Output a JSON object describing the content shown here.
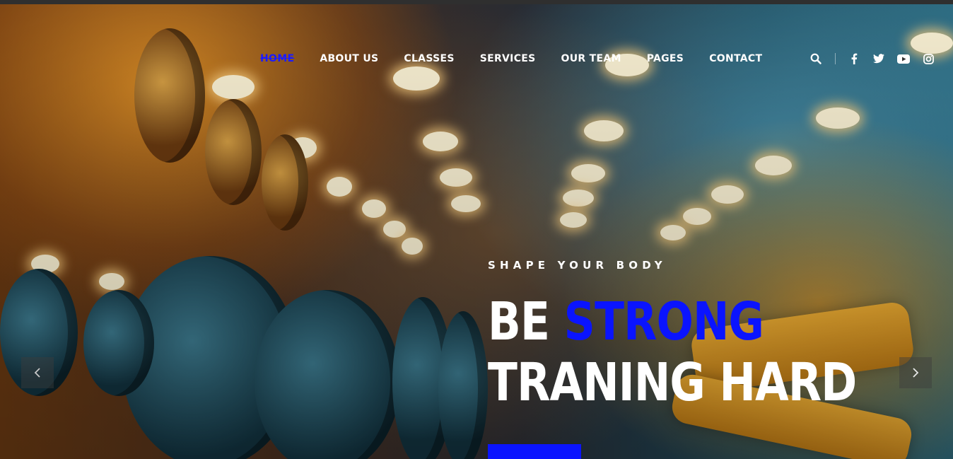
{
  "nav": {
    "items": [
      {
        "label": "HOME",
        "active": true
      },
      {
        "label": "ABOUT US"
      },
      {
        "label": "CLASSES"
      },
      {
        "label": "SERVICES"
      },
      {
        "label": "OUR TEAM"
      },
      {
        "label": "PAGES"
      },
      {
        "label": "CONTACT"
      }
    ]
  },
  "tools": {
    "icons": [
      "search-icon",
      "facebook-icon",
      "twitter-icon",
      "youtube-icon",
      "instagram-icon"
    ]
  },
  "hero": {
    "subtitle": "SHAPE YOUR BODY",
    "headline_line1_part1": "BE",
    "headline_line1_accent": "STRONG",
    "headline_line2": "TRANING HARD"
  },
  "slider": {
    "prev_icon": "chevron-left-icon",
    "next_icon": "chevron-right-icon"
  },
  "colors": {
    "accent": "#0a14ff",
    "text": "#ffffff"
  }
}
